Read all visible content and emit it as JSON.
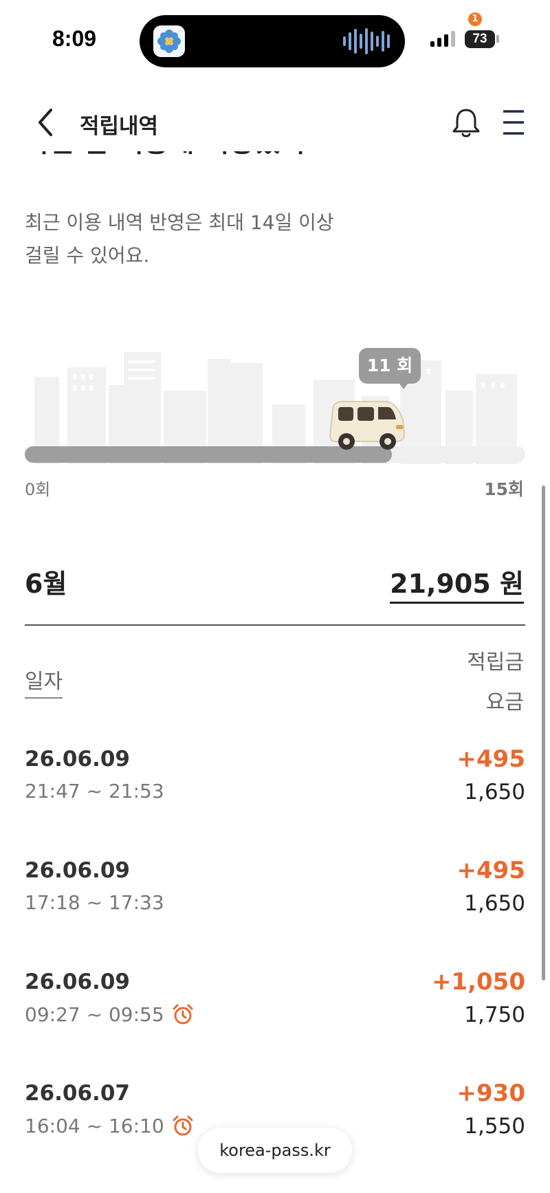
{
  "status_bar": {
    "time": "8:09",
    "battery": "73"
  },
  "header": {
    "title": "적립내역",
    "notification_count": "1"
  },
  "headline_partial": "이번 달 이용해 저장했어요.",
  "notice": {
    "line1": "최근 이용 내역 반영은 최대 14일 이상",
    "line2": "걸릴 수 있어요."
  },
  "progress": {
    "current_label": "11 회",
    "min_label": "0회",
    "max_label": "15회",
    "current": 11,
    "max": 15
  },
  "summary": {
    "month": "6월",
    "total": "21,905 원"
  },
  "columns": {
    "date": "일자",
    "reward": "적립금",
    "fare": "요금"
  },
  "history": [
    {
      "date": "26.06.09",
      "time": "21:47 ~ 21:53",
      "reward": "+495",
      "fare": "1,650",
      "alarm": false
    },
    {
      "date": "26.06.09",
      "time": "17:18 ~ 17:33",
      "reward": "+495",
      "fare": "1,650",
      "alarm": false
    },
    {
      "date": "26.06.09",
      "time": "09:27 ~ 09:55",
      "reward": "+1,050",
      "fare": "1,750",
      "alarm": true
    },
    {
      "date": "26.06.07",
      "time": "16:04 ~ 16:10",
      "reward": "+930",
      "fare": "1,550",
      "alarm": true
    }
  ],
  "url": "korea-pass.kr",
  "colors": {
    "accent": "#e8692e",
    "badge": "#f07a2a",
    "nav_icon": "#1f2a44",
    "bubble": "#9b9b9b"
  },
  "icons": [
    "back-arrow-icon",
    "bell-icon",
    "menu-icon",
    "alarm-clock-icon",
    "van-icon",
    "signal-icon",
    "battery-icon"
  ]
}
